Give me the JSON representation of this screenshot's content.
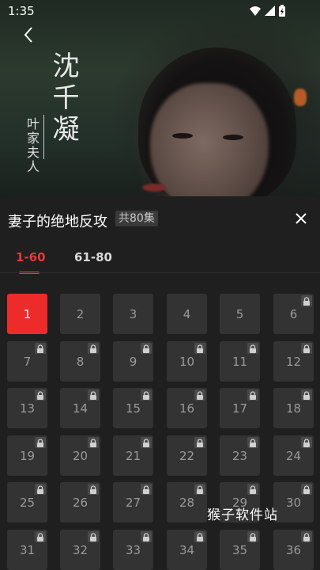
{
  "status_bar": {
    "time": "1:35"
  },
  "video": {
    "title_vertical": "沈千凝",
    "subtitle_vertical": "叶家夫人"
  },
  "sheet": {
    "drama_title": "妻子的绝地反攻",
    "episode_count": "共80集",
    "tabs": [
      {
        "label": "1-60",
        "active": true
      },
      {
        "label": "61-80",
        "active": false
      }
    ],
    "episodes": [
      {
        "n": "1",
        "locked": false,
        "active": true
      },
      {
        "n": "2",
        "locked": false
      },
      {
        "n": "3",
        "locked": false
      },
      {
        "n": "4",
        "locked": false
      },
      {
        "n": "5",
        "locked": false
      },
      {
        "n": "6",
        "locked": true
      },
      {
        "n": "7",
        "locked": true
      },
      {
        "n": "8",
        "locked": true
      },
      {
        "n": "9",
        "locked": true
      },
      {
        "n": "10",
        "locked": true
      },
      {
        "n": "11",
        "locked": true
      },
      {
        "n": "12",
        "locked": true
      },
      {
        "n": "13",
        "locked": true
      },
      {
        "n": "14",
        "locked": true
      },
      {
        "n": "15",
        "locked": true
      },
      {
        "n": "16",
        "locked": true
      },
      {
        "n": "17",
        "locked": true
      },
      {
        "n": "18",
        "locked": true
      },
      {
        "n": "19",
        "locked": true
      },
      {
        "n": "20",
        "locked": true
      },
      {
        "n": "21",
        "locked": true
      },
      {
        "n": "22",
        "locked": true
      },
      {
        "n": "23",
        "locked": true
      },
      {
        "n": "24",
        "locked": true
      },
      {
        "n": "25",
        "locked": true
      },
      {
        "n": "26",
        "locked": true
      },
      {
        "n": "27",
        "locked": true
      },
      {
        "n": "28",
        "locked": true
      },
      {
        "n": "29",
        "locked": true
      },
      {
        "n": "30",
        "locked": true
      },
      {
        "n": "31",
        "locked": true
      },
      {
        "n": "32",
        "locked": true
      },
      {
        "n": "33",
        "locked": true
      },
      {
        "n": "34",
        "locked": true
      },
      {
        "n": "35",
        "locked": true
      },
      {
        "n": "36",
        "locked": true
      }
    ]
  },
  "watermark": "猴子软件站",
  "colors": {
    "accent": "#ee2b2b",
    "tile": "#333333",
    "sheet_bg": "#1f1f1f"
  }
}
